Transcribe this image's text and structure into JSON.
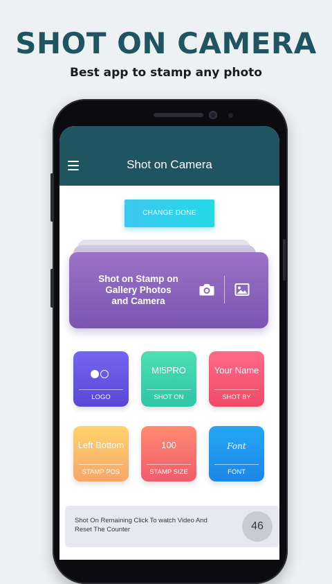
{
  "hero": {
    "title": "SHOT ON CAMERA",
    "subtitle": "Best app to stamp any photo"
  },
  "appbar": {
    "menu_icon": "hamburger-menu-icon",
    "title": "Shot on Camera"
  },
  "change_button": {
    "label": "CHANGE DONE"
  },
  "banner": {
    "text_line1": "Shot on Stamp on",
    "text_line2": "Gallery Photos",
    "text_line3": "and Camera",
    "icons": [
      "camera-icon",
      "gallery-icon"
    ]
  },
  "tiles": [
    {
      "value": "",
      "label": "LOGO",
      "colors": [
        "#7466f0",
        "#5a46d6"
      ]
    },
    {
      "value": "MI5PRO",
      "label": "SHOT ON",
      "colors": [
        "#4ee0b3",
        "#2ec4a7"
      ]
    },
    {
      "value": "Your Name",
      "label": "SHOT BY",
      "colors": [
        "#ff6a8a",
        "#ef4a66"
      ]
    },
    {
      "value": "Left Bottom",
      "label": "STAMP POS",
      "colors": [
        "#ffd36a",
        "#f7a66a"
      ]
    },
    {
      "value": "100",
      "label": "STAMP SIZE",
      "colors": [
        "#ff8a72",
        "#f05c6a"
      ]
    },
    {
      "value": "Font",
      "label": "FONT",
      "colors": [
        "#24a7f3",
        "#1c86e8"
      ]
    }
  ],
  "counter": {
    "text": "Shot On Remaining Click To watch Video And Reset The Counter",
    "value": "46"
  }
}
